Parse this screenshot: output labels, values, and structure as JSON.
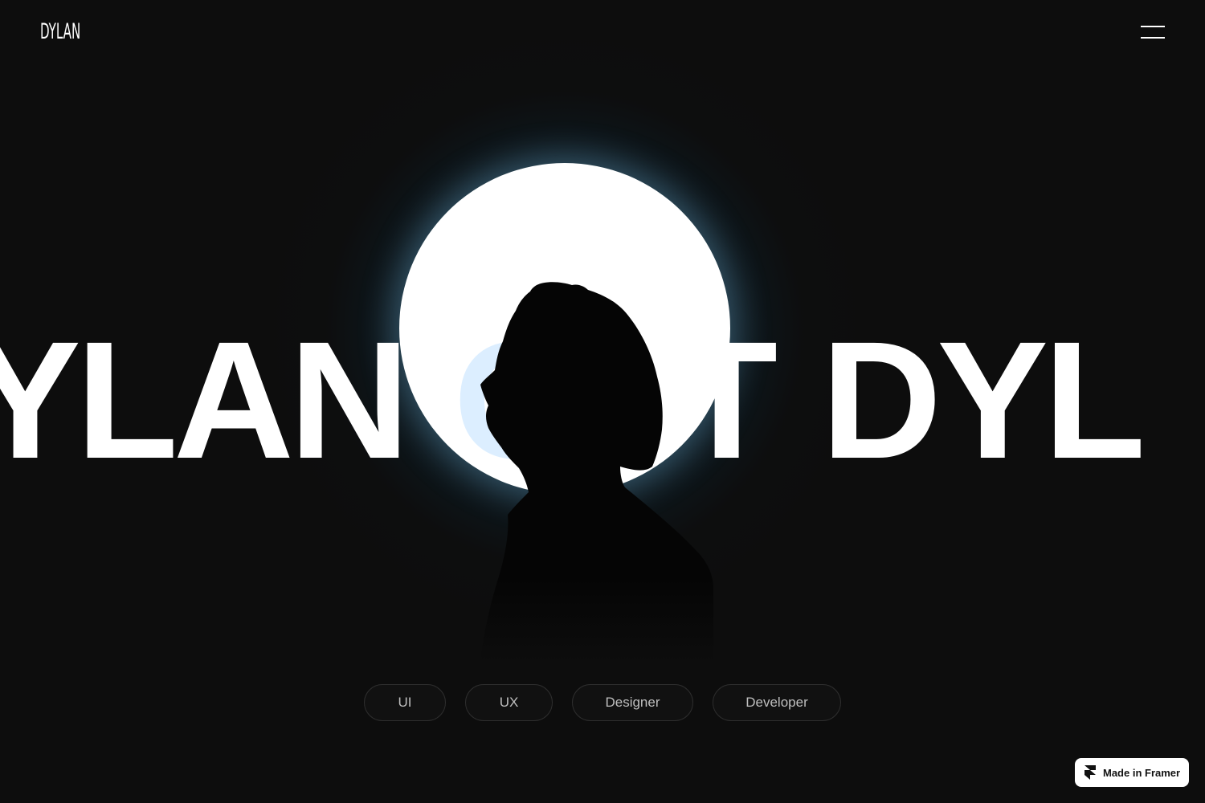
{
  "header": {
    "logo_text": "DYLAN",
    "menu_icon": "hamburger-icon"
  },
  "hero": {
    "marquee_segments": [
      "YLAN",
      "O",
      "FT",
      "DYL"
    ],
    "image": "profile-silhouette"
  },
  "tags": [
    {
      "label": "UI"
    },
    {
      "label": "UX"
    },
    {
      "label": "Designer"
    },
    {
      "label": "Developer"
    }
  ],
  "badge": {
    "label": "Made in Framer",
    "icon": "framer-icon"
  },
  "colors": {
    "background": "#0d0d0d",
    "text": "#ffffff",
    "glow": "#1e6e96",
    "tag_border": "#2e2e2e",
    "tag_text": "#bfbfbf"
  }
}
